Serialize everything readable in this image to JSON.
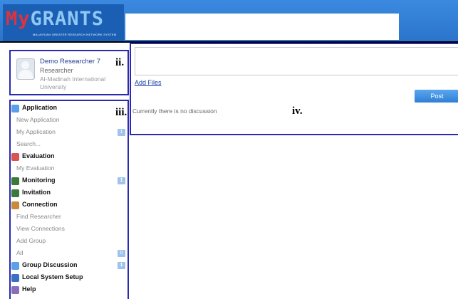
{
  "header": {
    "logo_my": "My",
    "logo_grants": "GRANTS",
    "logo_tagline": "MALAYSIAN GREATER RESEARCH NETWORK SYSTEM"
  },
  "profile": {
    "name": "Demo Researcher 7",
    "role": "Researcher",
    "institution": "Al-Madinah International University",
    "marker": "ii."
  },
  "sidebar": {
    "marker": "iii.",
    "items": [
      {
        "type": "section",
        "label": "Application",
        "icon": "application-icon",
        "color": "#5aa0e6"
      },
      {
        "type": "sub",
        "label": "New Application"
      },
      {
        "type": "sub",
        "label": "My Application",
        "badge": "1"
      },
      {
        "type": "sub",
        "label": "Search..."
      },
      {
        "type": "section",
        "label": "Evaluation",
        "icon": "evaluation-icon",
        "color": "#d9534f"
      },
      {
        "type": "sub",
        "label": "My Evaluation"
      },
      {
        "type": "section",
        "label": "Monitoring",
        "icon": "monitoring-icon",
        "color": "#3a7a3a",
        "badge": "1"
      },
      {
        "type": "section",
        "label": "Invitation",
        "icon": "invitation-icon",
        "color": "#3a7a3a"
      },
      {
        "type": "section",
        "label": "Connection",
        "icon": "connection-icon",
        "color": "#c98a3a"
      },
      {
        "type": "sub",
        "label": "Find Researcher"
      },
      {
        "type": "sub",
        "label": "View Connections"
      },
      {
        "type": "sub",
        "label": "Add Group"
      },
      {
        "type": "sub",
        "label": "All",
        "badge": "0"
      },
      {
        "type": "section",
        "label": "Group Discussion",
        "icon": "group-discussion-icon",
        "color": "#5aa0e6",
        "badge": "1"
      },
      {
        "type": "section",
        "label": "Local System Setup",
        "icon": "settings-icon",
        "color": "#3b6fc2"
      },
      {
        "type": "section",
        "label": "Help",
        "icon": "help-icon",
        "color": "#8a6fb8"
      }
    ]
  },
  "main": {
    "marker": "iv.",
    "post_placeholder": "",
    "add_files_label": "Add Files",
    "post_button_label": "Post",
    "empty_message": "Currently there is no discussion"
  }
}
